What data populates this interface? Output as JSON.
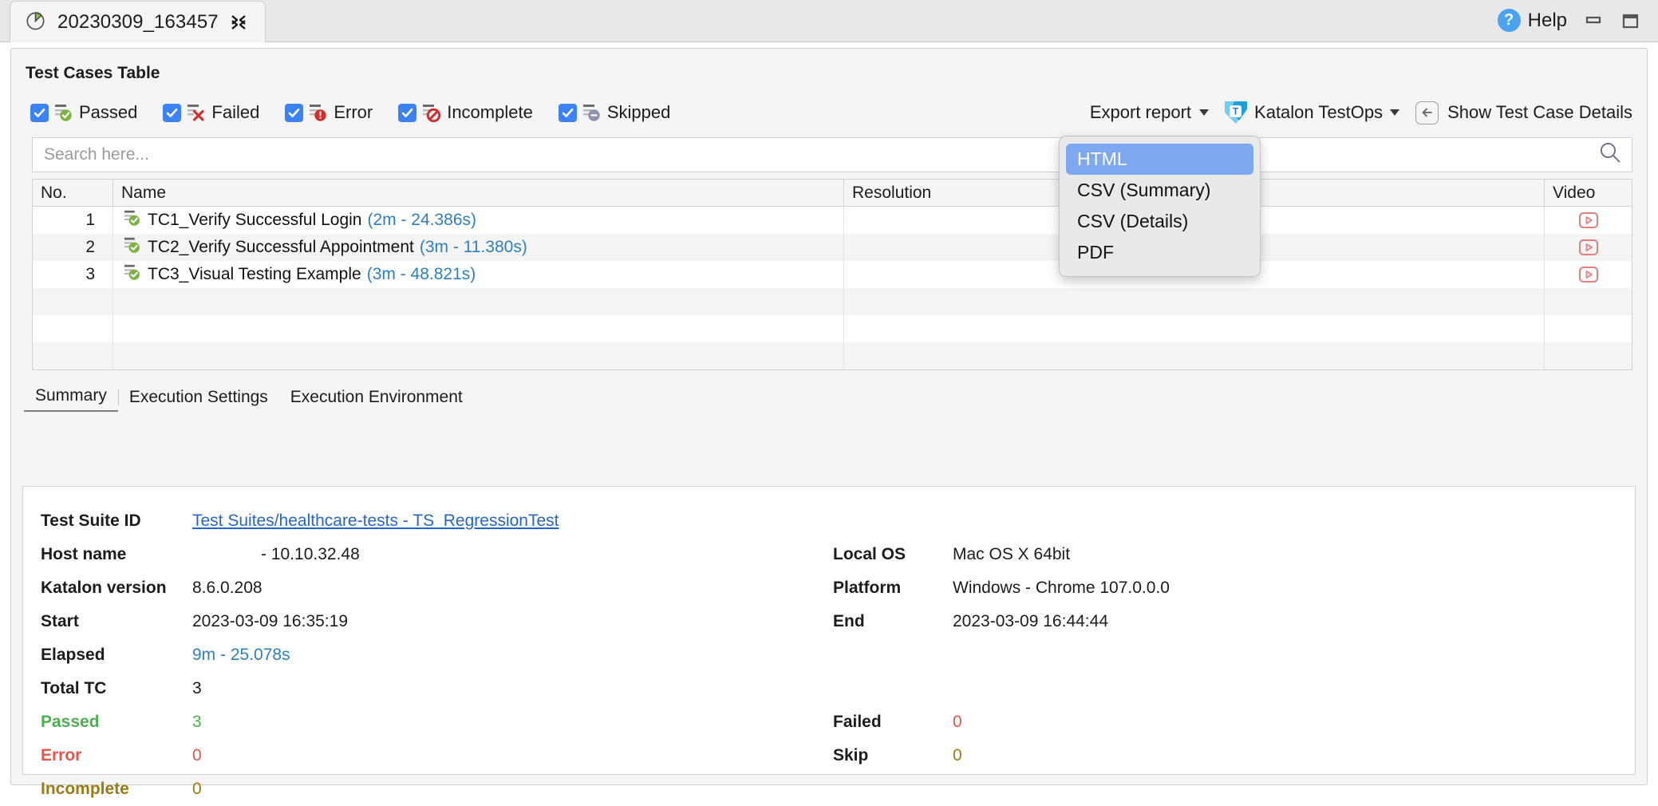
{
  "titlebar": {
    "tab_title": "20230309_163457",
    "close_icon": "close-x-icon",
    "report_icon": "pie-chart-icon",
    "help_label": "Help",
    "help_glyph": "?",
    "minimize_icon": "minimize-icon",
    "maximize_icon": "maximize-icon"
  },
  "panel": {
    "header": "Test Cases Table"
  },
  "filters": [
    {
      "label": "Passed",
      "checked": true,
      "icon": "status-passed-icon"
    },
    {
      "label": "Failed",
      "checked": true,
      "icon": "status-failed-icon"
    },
    {
      "label": "Error",
      "checked": true,
      "icon": "status-error-icon"
    },
    {
      "label": "Incomplete",
      "checked": true,
      "icon": "status-incomplete-icon"
    },
    {
      "label": "Skipped",
      "checked": true,
      "icon": "status-skipped-icon"
    }
  ],
  "toolbar": {
    "export_label": "Export report",
    "testops_label": "Katalon TestOps",
    "testops_icon": "katalon-testops-icon",
    "details_label": "Show Test Case Details",
    "back_icon": "arrow-left-icon",
    "caret_icon": "chevron-down-icon"
  },
  "export_menu": {
    "items": [
      {
        "label": "HTML",
        "selected": true
      },
      {
        "label": "CSV (Summary)",
        "selected": false
      },
      {
        "label": "CSV (Details)",
        "selected": false
      },
      {
        "label": "PDF",
        "selected": false
      }
    ]
  },
  "search": {
    "placeholder": "Search here...",
    "value": "",
    "icon": "search-icon"
  },
  "table": {
    "columns": [
      "No.",
      "Name",
      "Resolution",
      "Video"
    ],
    "rows": [
      {
        "no": "1",
        "status_icon": "status-passed-icon",
        "name": "TC1_Verify Successful Login",
        "duration": "(2m - 24.386s)",
        "resolution": "",
        "video_icon": "video-play-icon"
      },
      {
        "no": "2",
        "status_icon": "status-passed-icon",
        "name": "TC2_Verify Successful Appointment",
        "duration": "(3m - 11.380s)",
        "resolution": "",
        "video_icon": "video-play-icon"
      },
      {
        "no": "3",
        "status_icon": "status-passed-icon",
        "name": "TC3_Visual Testing Example",
        "duration": "(3m - 48.821s)",
        "resolution": "",
        "video_icon": "video-play-icon"
      }
    ],
    "empty_rows": 3
  },
  "tabs": [
    {
      "label": "Summary",
      "active": true
    },
    {
      "label": "Execution Settings",
      "active": false
    },
    {
      "label": "Execution Environment",
      "active": false
    }
  ],
  "summary": {
    "test_suite_id_label": "Test Suite ID",
    "test_suite_id_value": "Test Suites/healthcare-tests - TS_RegressionTest",
    "host_name_label": "Host name",
    "host_name_value": "- 10.10.32.48",
    "katalon_version_label": "Katalon version",
    "katalon_version_value": "8.6.0.208",
    "start_label": "Start",
    "start_value": "2023-03-09 16:35:19",
    "elapsed_label": "Elapsed",
    "elapsed_value": "9m - 25.078s",
    "total_tc_label": "Total TC",
    "total_tc_value": "3",
    "passed_label": "Passed",
    "passed_value": "3",
    "error_label": "Error",
    "error_value": "0",
    "incomplete_label": "Incomplete",
    "incomplete_value": "0",
    "local_os_label": "Local OS",
    "local_os_value": "Mac OS X 64bit",
    "platform_label": "Platform",
    "platform_value": "Windows - Chrome 107.0.0.0",
    "end_label": "End",
    "end_value": "2023-03-09 16:44:44",
    "failed_label": "Failed",
    "failed_value": "0",
    "skip_label": "Skip",
    "skip_value": "0"
  },
  "colors": {
    "accent_blue": "#3b82f6",
    "menu_selected": "#7ea9f0",
    "link_blue": "#2566c9",
    "duration_blue": "#2d7fc1",
    "passed_green": "#4caf50",
    "failed_red": "#e2574c",
    "skip_gold": "#9a7b15",
    "video_red": "#e08080"
  }
}
